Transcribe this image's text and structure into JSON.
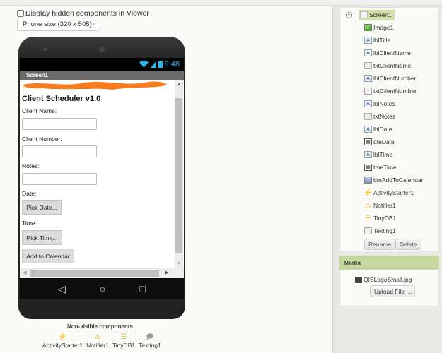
{
  "viewer": {
    "hidden_toggle_label": "Display hidden components in Viewer",
    "hidden_toggle_checked": false,
    "size_select_value": "Phone size (320 x 505)"
  },
  "phone": {
    "status_time": "9:48",
    "screen_title": "Screen1",
    "app_title": "Client Scheduler v1.0",
    "labels": {
      "client_name": "Client Name:",
      "client_number": "Client Number:",
      "notes": "Notes:",
      "date": "Date:",
      "time": "Time:"
    },
    "inputs": {
      "client_name": "",
      "client_number": "",
      "notes": ""
    },
    "buttons": {
      "pick_date": "Pick Date...",
      "pick_time": "Pick Time...",
      "add_to_calendar": "Add to Calendar"
    },
    "nav": {
      "back": "◁",
      "home": "○",
      "recents": "□"
    }
  },
  "nonvisible": {
    "title": "Non-visible components",
    "items": [
      {
        "label": "ActivityStarter1",
        "icon": "lightning-icon"
      },
      {
        "label": "Notifier1",
        "icon": "warning-icon"
      },
      {
        "label": "TinyDB1",
        "icon": "database-icon"
      },
      {
        "label": "Texting1",
        "icon": "speech-bubble-icon"
      }
    ]
  },
  "components": {
    "root": "Screen1",
    "items": [
      {
        "label": "Image1",
        "icon": "image-icon"
      },
      {
        "label": "lblTitle",
        "icon": "label-icon"
      },
      {
        "label": "lblClientName",
        "icon": "label-icon"
      },
      {
        "label": "txtClientName",
        "icon": "textbox-icon"
      },
      {
        "label": "lblClientNumber",
        "icon": "label-icon"
      },
      {
        "label": "txtClientNumber",
        "icon": "textbox-icon"
      },
      {
        "label": "lblNotes",
        "icon": "label-icon"
      },
      {
        "label": "txtNotes",
        "icon": "textbox-icon"
      },
      {
        "label": "lblDate",
        "icon": "label-icon"
      },
      {
        "label": "dteDate",
        "icon": "datepicker-icon"
      },
      {
        "label": "lblTime",
        "icon": "label-icon"
      },
      {
        "label": "tmeTime",
        "icon": "timepicker-icon"
      },
      {
        "label": "btnAddToCalendar",
        "icon": "button-icon"
      },
      {
        "label": "ActivityStarter1",
        "icon": "lightning-icon"
      },
      {
        "label": "Notifier1",
        "icon": "warning-icon"
      },
      {
        "label": "TinyDB1",
        "icon": "database-icon"
      },
      {
        "label": "Texting1",
        "icon": "speech-bubble-icon"
      }
    ],
    "rename_label": "Rename",
    "delete_label": "Delete"
  },
  "media": {
    "title": "Media",
    "file": "QISLogoSmall.jpg",
    "upload_label": "Upload File ..."
  },
  "colors": {
    "selected_bg": "#cfe0a8",
    "media_header_bg": "#c6d8a0",
    "status_icon": "#33b5e5",
    "redaction": "#f57c1f"
  }
}
